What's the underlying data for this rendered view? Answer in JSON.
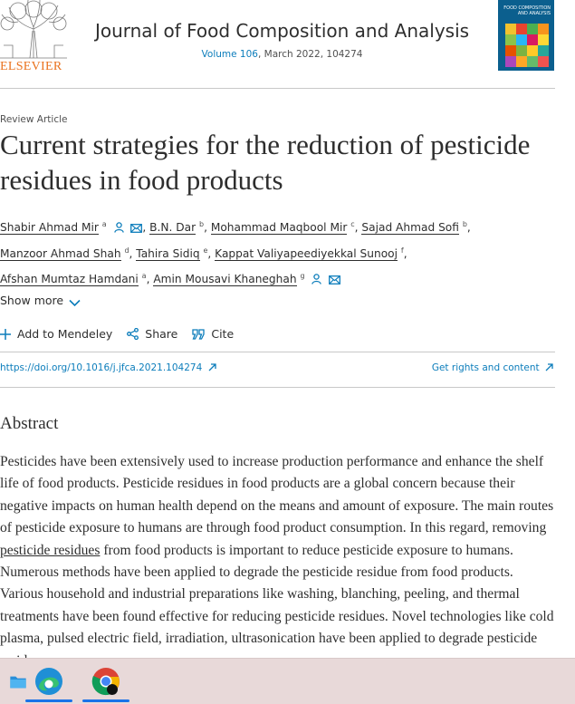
{
  "header": {
    "publisher": "ELSEVIER",
    "journal_title": "Journal of Food Composition and Analysis",
    "volume_link": "Volume 106",
    "issue_info": ", March 2022, 104274",
    "cover_text": "FOOD COMPOSITION AND ANALYSIS"
  },
  "article": {
    "type": "Review Article",
    "title": "Current strategies for the reduction of pesticide residues in food products",
    "authors": [
      {
        "name": "Shabir Ahmad Mir",
        "sup": "a"
      },
      {
        "name": "B.N. Dar",
        "sup": "b"
      },
      {
        "name": "Mohammad Maqbool Mir",
        "sup": "c"
      },
      {
        "name": "Sajad Ahmad Sofi",
        "sup": "b"
      },
      {
        "name": "Manzoor Ahmad Shah",
        "sup": "d"
      },
      {
        "name": "Tahira Sidiq",
        "sup": "e"
      },
      {
        "name": "Kappat Valiyapeediyekkal Sunooj",
        "sup": "f"
      },
      {
        "name": "Afshan Mumtaz Hamdani",
        "sup": "a"
      },
      {
        "name": "Amin Mousavi Khaneghah",
        "sup": "g"
      }
    ],
    "show_more": "Show more",
    "actions": {
      "mendeley": "Add to Mendeley",
      "share": "Share",
      "cite": "Cite"
    },
    "doi": "https://doi.org/10.1016/j.jfca.2021.104274",
    "rights": "Get rights and content"
  },
  "abstract": {
    "heading": "Abstract",
    "text_before": "Pesticides have been extensively used to increase production performance and enhance the shelf life of food products. Pesticide residues in food products are a global concern because their negative impacts on human health depend on the means and amount of exposure. The main routes of pesticide exposure to humans are through food product consumption. In this regard, removing ",
    "keyword": "pesticide residues",
    "text_after": " from food products is important to reduce pesticide exposure to humans. Numerous methods have been applied to degrade the pesticide residue from food products. Various household and industrial preparations like washing, blanching, peeling, and thermal treatments have been found effective for reducing pesticide residues. Novel technologies like cold plasma, pulsed electric field, irradiation, ultrasonication have been applied to degrade pesticide residues."
  },
  "taskbar": {
    "apps": [
      "file-explorer-icon",
      "edge-icon",
      "chrome-icon"
    ],
    "accent": "#1a73e8"
  }
}
